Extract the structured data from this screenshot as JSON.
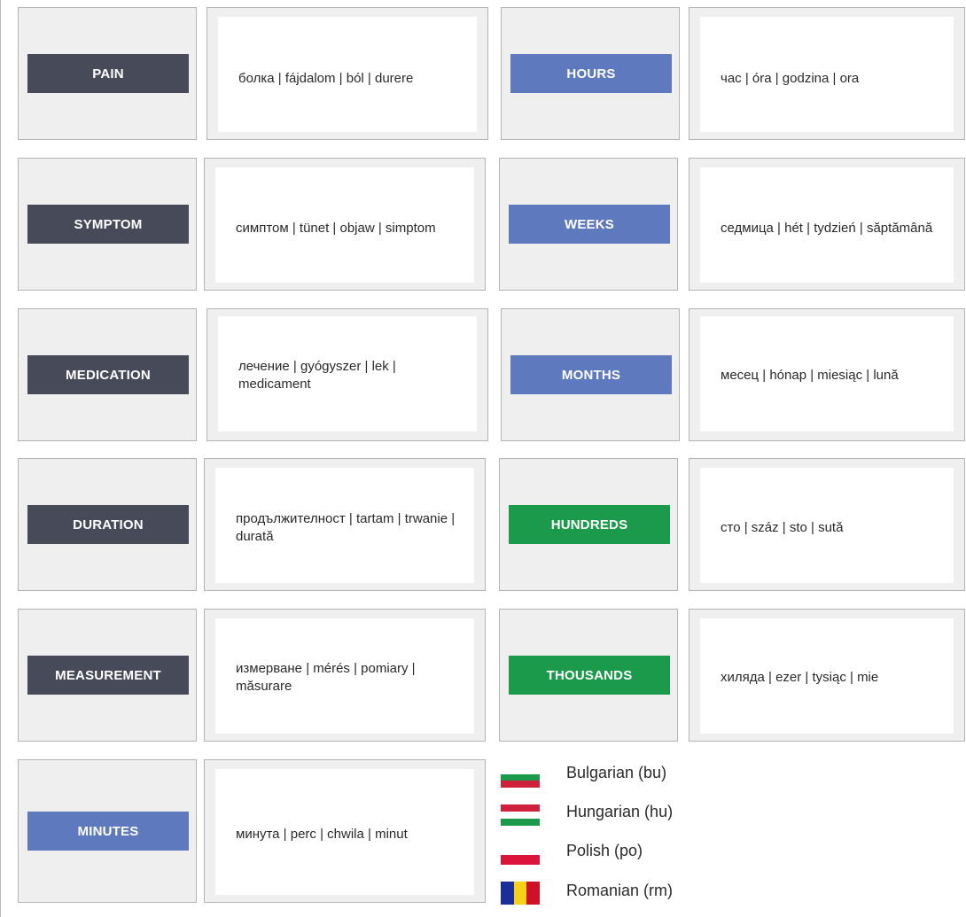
{
  "colors": {
    "dark": "#474a58",
    "blue": "#5f79bf",
    "green": "#1a9a4a"
  },
  "cards": [
    {
      "label": "PAIN",
      "color": "dark",
      "words": "болка | fájdalom | ból | durere"
    },
    {
      "label": "HOURS",
      "color": "blue",
      "words": "час | óra | godzina | ora"
    },
    {
      "label": "SYMPTOM",
      "color": "dark",
      "words": "симптом | tünet | objaw | simptom"
    },
    {
      "label": "WEEKS",
      "color": "blue",
      "words": "седмица | hét | tydzień | săptămână"
    },
    {
      "label": "MEDICATION",
      "color": "dark",
      "words": "лечение | gyógyszer | lek | medicament"
    },
    {
      "label": "MONTHS",
      "color": "blue",
      "words": "месец | hónap | miesiąc | lună"
    },
    {
      "label": "DURATION",
      "color": "dark",
      "words": "продължителност | tartam | trwanie | durată"
    },
    {
      "label": "HUNDREDS",
      "color": "green",
      "words": "сто | száz | sto | sută"
    },
    {
      "label": "MEASUREMENT",
      "color": "dark",
      "words": "измерване | mérés | pomiary | măsurare"
    },
    {
      "label": "THOUSANDS",
      "color": "green",
      "words": "хиляда | ezer | tysiąc | mie"
    },
    {
      "label": "MINUTES",
      "color": "blue",
      "words": "минута | perc | chwila | minut"
    }
  ],
  "legend": [
    {
      "name": "Bulgarian (bu)",
      "flag": "bulgarian-flag"
    },
    {
      "name": "Hungarian (hu)",
      "flag": "hungarian-flag"
    },
    {
      "name": "Polish (po)",
      "flag": "polish-flag"
    },
    {
      "name": "Romanian (rm)",
      "flag": "romanian-flag"
    }
  ]
}
